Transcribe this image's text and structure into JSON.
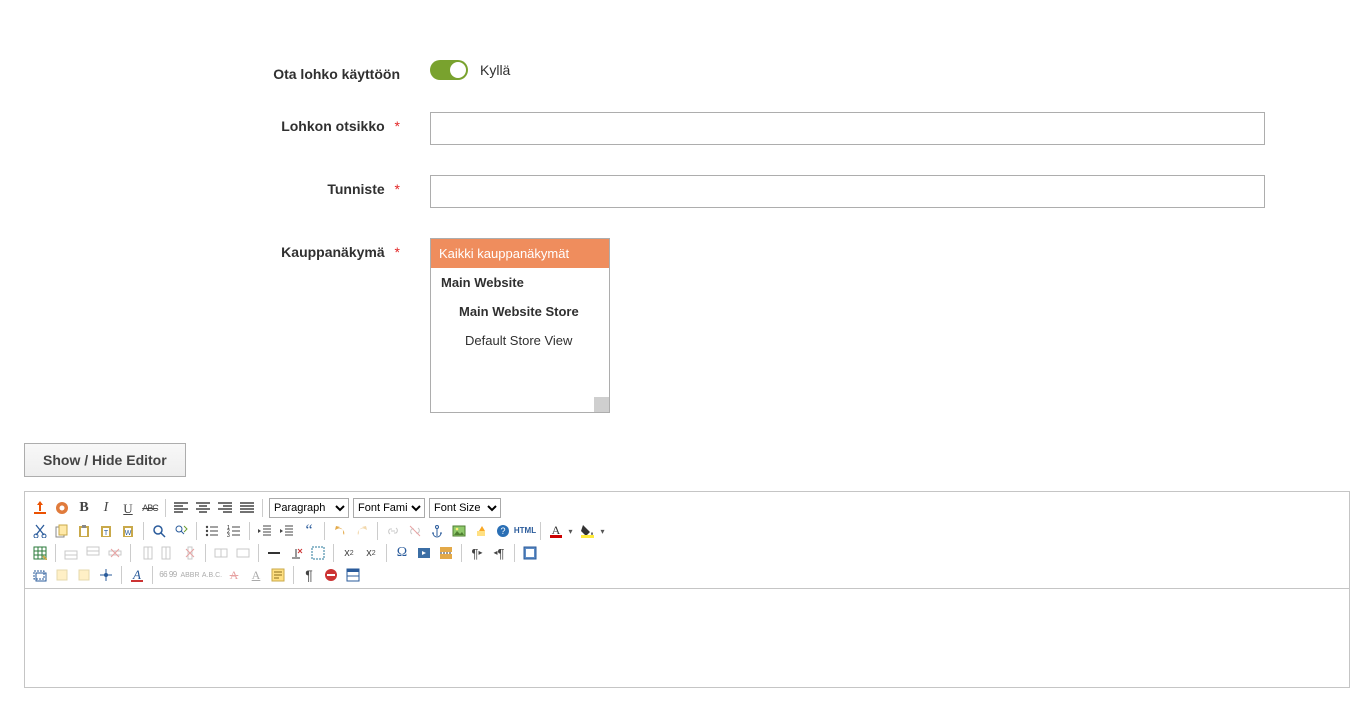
{
  "fields": {
    "enable": {
      "label": "Ota lohko käyttöön",
      "value_label": "Kyllä"
    },
    "title": {
      "label": "Lohkon otsikko",
      "value": ""
    },
    "identifier": {
      "label": "Tunniste",
      "value": ""
    },
    "storeview": {
      "label": "Kauppanäkymä",
      "options": [
        {
          "label": "Kaikki kauppanäkymät",
          "depth": 0,
          "selected": true
        },
        {
          "label": "Main Website",
          "depth": 1,
          "selected": false
        },
        {
          "label": "Main Website Store",
          "depth": 2,
          "selected": false
        },
        {
          "label": "Default Store View",
          "depth": 3,
          "selected": false
        }
      ]
    }
  },
  "editor": {
    "toggle_button": "Show / Hide Editor",
    "format_select": "Paragraph",
    "font_family_select": "Font Family",
    "font_size_select": "Font Size",
    "html_label": "HTML"
  },
  "required_marker": "*"
}
